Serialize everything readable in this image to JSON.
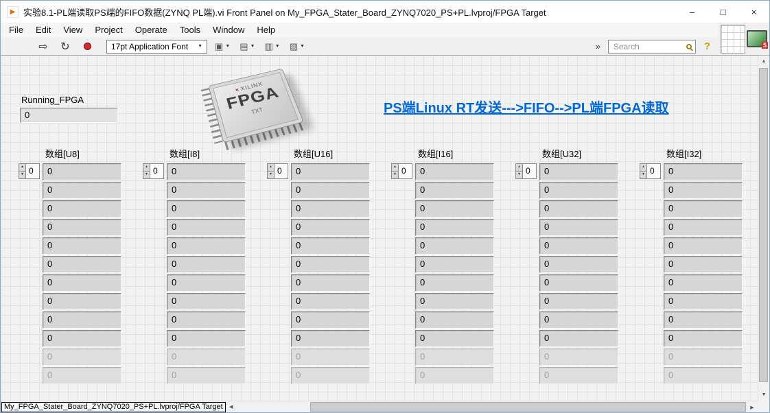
{
  "window": {
    "title": "实验8.1-PL端读取PS端的FIFO数据(ZYNQ PL端).vi Front Panel on My_FPGA_Stater_Board_ZYNQ7020_PS+PL.lvproj/FPGA Target",
    "minimize": "–",
    "maximize": "□",
    "close": "×"
  },
  "menu": {
    "items": [
      "File",
      "Edit",
      "View",
      "Project",
      "Operate",
      "Tools",
      "Window",
      "Help"
    ]
  },
  "toolbar": {
    "font_selector": "17pt Application Font",
    "search_placeholder": "Search"
  },
  "icons": {
    "app": "▶",
    "run": "⇨",
    "run_continuous": "↻",
    "dropdown": "▼",
    "align": "▣",
    "distribute": "▤",
    "resize": "▥",
    "reorder": "▨",
    "overflow": "»",
    "help": "?",
    "xilinx": "×"
  },
  "corner": {
    "badge": "5"
  },
  "panel": {
    "running": {
      "label": "Running_FPGA",
      "value": "0"
    },
    "chip": {
      "brand": "XILINX",
      "name": "FPGA",
      "sub": "TXT"
    },
    "banner": {
      "text": "PS端Linux RT发送--->FIFO-->PL端FPGA读取",
      "color": "#0068D8"
    },
    "arrays": [
      {
        "label": "数组[U8]",
        "index": "0",
        "values": [
          "0",
          "0",
          "0",
          "0",
          "0",
          "0",
          "0",
          "0",
          "0",
          "0",
          "0",
          "0"
        ],
        "dimmed_from": 10
      },
      {
        "label": "数组[I8]",
        "index": "0",
        "values": [
          "0",
          "0",
          "0",
          "0",
          "0",
          "0",
          "0",
          "0",
          "0",
          "0",
          "0",
          "0"
        ],
        "dimmed_from": 10
      },
      {
        "label": "数组[U16]",
        "index": "0",
        "values": [
          "0",
          "0",
          "0",
          "0",
          "0",
          "0",
          "0",
          "0",
          "0",
          "0",
          "0",
          "0"
        ],
        "dimmed_from": 10
      },
      {
        "label": "数组[I16]",
        "index": "0",
        "values": [
          "0",
          "0",
          "0",
          "0",
          "0",
          "0",
          "0",
          "0",
          "0",
          "0",
          "0",
          "0"
        ],
        "dimmed_from": 10
      },
      {
        "label": "数组[U32]",
        "index": "0",
        "values": [
          "0",
          "0",
          "0",
          "0",
          "0",
          "0",
          "0",
          "0",
          "0",
          "0",
          "0",
          "0"
        ],
        "dimmed_from": 10
      },
      {
        "label": "数组[I32]",
        "index": "0",
        "values": [
          "0",
          "0",
          "0",
          "0",
          "0",
          "0",
          "0",
          "0",
          "0",
          "0",
          "0",
          "0"
        ],
        "dimmed_from": 10
      }
    ]
  },
  "statusbar": {
    "target": "My_FPGA_Stater_Board_ZYNQ7020_PS+PL.lvproj/FPGA Target"
  }
}
